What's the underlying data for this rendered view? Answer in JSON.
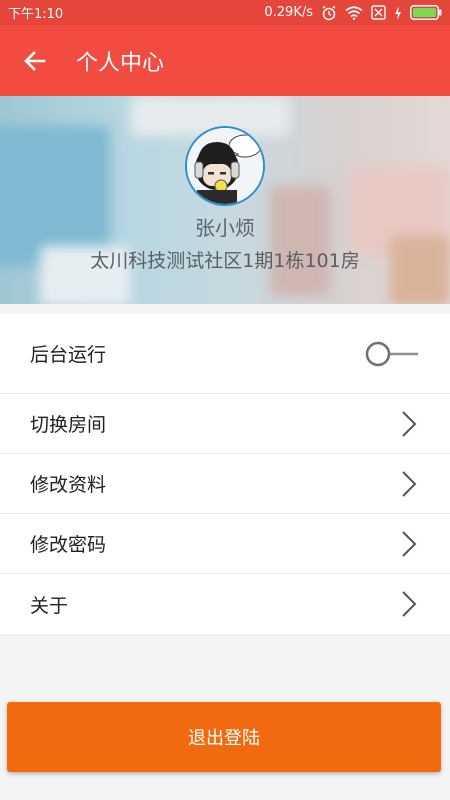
{
  "status_bar": {
    "time": "下午1:10",
    "network_speed": "0.29K/s",
    "icons": [
      "alarm-icon",
      "wifi-icon",
      "sim-off-icon",
      "charging-icon",
      "battery-icon"
    ],
    "battery_color": "#7cd957"
  },
  "header": {
    "title": "个人中心",
    "back_icon": "arrow-left-icon",
    "color": "#f24b40"
  },
  "profile": {
    "name": "张小烦",
    "address": "太川科技测试社区1期1栋101房"
  },
  "menu": {
    "items": [
      {
        "label": "后台运行",
        "control": "toggle",
        "enabled": false
      },
      {
        "label": "切换房间",
        "control": "chevron"
      },
      {
        "label": "修改资料",
        "control": "chevron"
      },
      {
        "label": "修改密码",
        "control": "chevron"
      },
      {
        "label": "关于",
        "control": "chevron"
      }
    ]
  },
  "logout": {
    "label": "退出登陆",
    "color": "#f26a10"
  }
}
